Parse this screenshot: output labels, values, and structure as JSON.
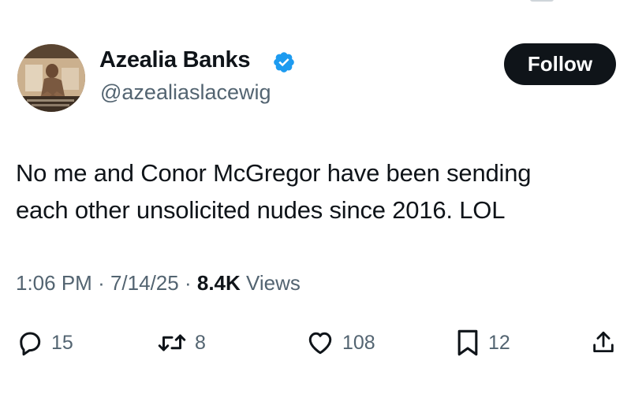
{
  "user": {
    "display_name": "Azealia Banks",
    "handle": "@azealiaslacewig",
    "verified": true
  },
  "follow_button": {
    "label": "Follow"
  },
  "tweet": {
    "text_lines": [
      "No me and Conor McGregor have been sending",
      "each other unsolicited nudes since 2016. LOL"
    ],
    "time": "1:06 PM",
    "date": "7/14/25",
    "separator": "·",
    "views_count": "8.4K",
    "views_label": "Views"
  },
  "actions": {
    "reply": {
      "icon": "reply-icon",
      "count": "15"
    },
    "retweet": {
      "icon": "retweet-icon",
      "count": "8"
    },
    "like": {
      "icon": "heart-icon",
      "count": "108"
    },
    "bookmark": {
      "icon": "bookmark-icon",
      "count": "12"
    },
    "share": {
      "icon": "share-icon"
    }
  },
  "colors": {
    "text_primary": "#0f1419",
    "text_secondary": "#536471",
    "verified_blue": "#1d9bf0",
    "follow_bg": "#0f1419",
    "follow_text": "#ffffff"
  }
}
